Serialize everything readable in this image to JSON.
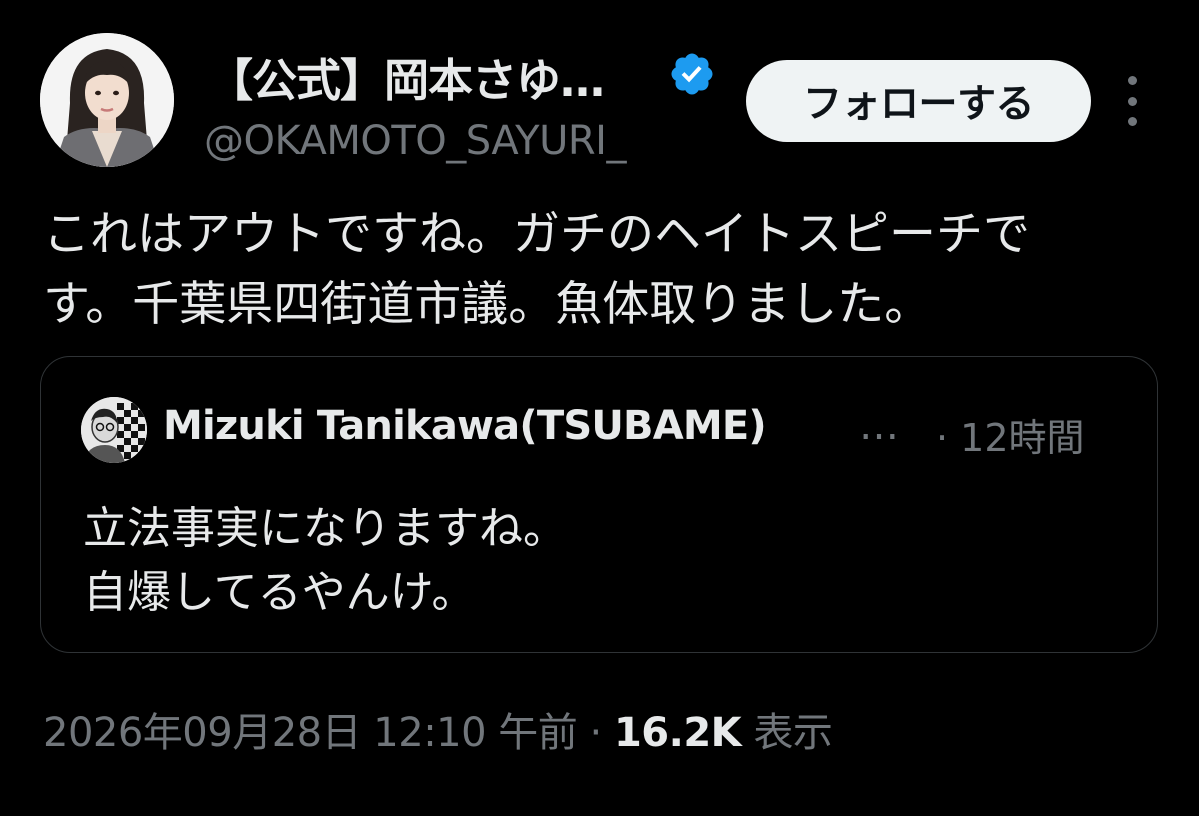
{
  "author": {
    "display_name": "【公式】岡本さゆ…",
    "handle": "@OKAMOTO_SAYURI_",
    "verified_icon": "verified-badge-icon",
    "avatar_icon": "profile-photo"
  },
  "actions": {
    "follow_label": "フォローする",
    "more_icon": "vertical-ellipsis-icon"
  },
  "tweet": {
    "text_lines": [
      "これはアウトですね。ガチのヘイトスピーチで",
      "す。千葉県四街道市議。魚体取りました。"
    ]
  },
  "quote": {
    "author_name": "Mizuki Tanikawa(TSUBAME)",
    "ellipsis": "…",
    "time": "· 12時間",
    "text_lines": [
      "立法事実になりますね。",
      "自爆してるやんけ。"
    ]
  },
  "footer": {
    "timestamp": "2026年09月28日 12:10 午前",
    "separator": "·",
    "views_count": "16.2K",
    "views_label": "表示"
  },
  "colors": {
    "background": "#000000",
    "primary_text": "#e7e9ea",
    "secondary_text": "#71767b",
    "verified_blue": "#1d9bf0",
    "border": "#2f3336",
    "button_bg": "#eff3f4"
  }
}
